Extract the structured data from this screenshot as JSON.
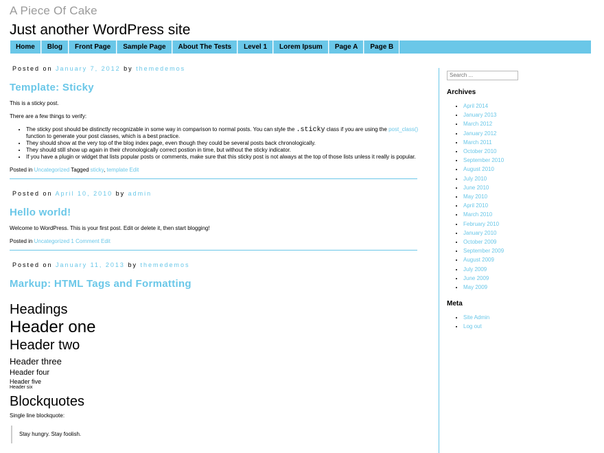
{
  "site": {
    "title": "A Piece Of Cake",
    "description": "Just another WordPress site"
  },
  "nav": [
    "Home",
    "Blog",
    "Front Page",
    "Sample Page",
    "About The Tests",
    "Level 1",
    "Lorem Ipsum",
    "Page A",
    "Page B"
  ],
  "posts": [
    {
      "meta_prefix": "Posted on",
      "date": "January 7, 2012",
      "by": "by",
      "author": "themedemos",
      "title": "Template: Sticky",
      "p1": "This is a sticky post.",
      "p2": "There are a few things to verify:",
      "li1_a": "The sticky post should be distinctly recognizable in some way in comparison to normal posts. You can style the",
      "li1_code": ".sticky",
      "li1_b": "class if you are using the",
      "li1_link": "post_class()",
      "li1_c": "function to generate your post classes, which is a best practice.",
      "li2": "They should show at the very top of the blog index page, even though they could be several posts back chronologically.",
      "li3": "They should still show up again in their chronologically correct postion in time, but without the sticky indicator.",
      "li4": "If you have a plugin or widget that lists popular posts or comments, make sure that this sticky post is not always at the top of those lists unless it really is popular.",
      "footer_prefix": "Posted in",
      "category": "Uncategorized",
      "tagged": "Tagged",
      "tag1": "sticky",
      "tag2": "template",
      "edit": "Edit"
    },
    {
      "meta_prefix": "Posted on",
      "date": "April 10, 2010",
      "by": "by",
      "author": "admin",
      "title": "Hello world!",
      "p1": "Welcome to WordPress. This is your first post. Edit or delete it, then start blogging!",
      "footer_prefix": "Posted in",
      "category": "Uncategorized",
      "comments": "1 Comment",
      "edit": "Edit"
    },
    {
      "meta_prefix": "Posted on",
      "date": "January 11, 2013",
      "by": "by",
      "author": "themedemos",
      "title": "Markup: HTML Tags and Formatting",
      "headings": "Headings",
      "h1": "Header one",
      "h2": "Header two",
      "h3": "Header three",
      "h4": "Header four",
      "h5": "Header five",
      "h6": "Header six",
      "blockquotes": "Blockquotes",
      "single_line": "Single line blockquote:",
      "quote": "Stay hungry. Stay foolish."
    }
  ],
  "sidebar": {
    "search_placeholder": "Search ...",
    "archives_title": "Archives",
    "archives": [
      "April 2014",
      "January 2013",
      "March 2012",
      "January 2012",
      "March 2011",
      "October 2010",
      "September 2010",
      "August 2010",
      "July 2010",
      "June 2010",
      "May 2010",
      "April 2010",
      "March 2010",
      "February 2010",
      "January 2010",
      "October 2009",
      "September 2009",
      "August 2009",
      "July 2009",
      "June 2009",
      "May 2009"
    ],
    "meta_title": "Meta",
    "meta": [
      "Site Admin",
      "Log out"
    ]
  },
  "colors": {
    "accent": "#6ac7e8",
    "title_gray": "#9a9a9a"
  }
}
